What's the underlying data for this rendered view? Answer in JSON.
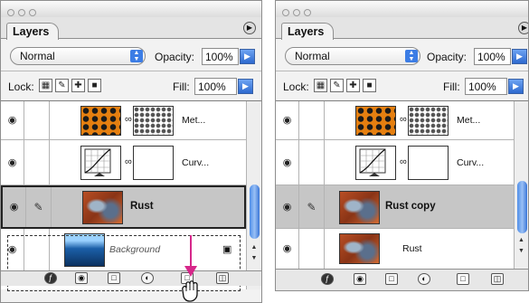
{
  "panels": [
    {
      "tab_title": "Layers",
      "blend_mode": "Normal",
      "opacity_label": "Opacity:",
      "opacity_value": "100%",
      "lock_label": "Lock:",
      "fill_label": "Fill:",
      "fill_value": "100%",
      "layers": [
        {
          "name": "Met...",
          "thumb": "honeycomb",
          "mask": "hex-mask",
          "selected": false,
          "visible": true,
          "brush": false
        },
        {
          "name": "Curv...",
          "thumb": "curves-adjustment",
          "mask": "blank-mask",
          "selected": false,
          "visible": true,
          "brush": false
        },
        {
          "name": "Rust",
          "thumb": "rust-texture",
          "selected": true,
          "visible": true,
          "brush": true
        },
        {
          "name": "Background",
          "thumb": "ocean-photo",
          "selected": false,
          "visible": true,
          "brush": false,
          "locked": true
        }
      ],
      "annotation": {
        "drag_target": "new-layer-button",
        "cursor": "grab-hand-cursor",
        "arrow_color": "#d6278a"
      }
    },
    {
      "tab_title": "Layers",
      "blend_mode": "Normal",
      "opacity_label": "Opacity:",
      "opacity_value": "100%",
      "lock_label": "Lock:",
      "fill_label": "Fill:",
      "fill_value": "100%",
      "layers": [
        {
          "name": "Met...",
          "thumb": "honeycomb",
          "mask": "hex-mask",
          "selected": false,
          "visible": true,
          "brush": false
        },
        {
          "name": "Curv...",
          "thumb": "curves-adjustment",
          "mask": "blank-mask",
          "selected": false,
          "visible": true,
          "brush": false
        },
        {
          "name": "Rust copy",
          "thumb": "rust-texture",
          "selected": true,
          "visible": true,
          "brush": true
        },
        {
          "name": "Rust",
          "thumb": "rust-texture",
          "selected": false,
          "visible": true,
          "brush": false
        }
      ]
    }
  ],
  "icons": {
    "bottom_bar": [
      "layer-style-icon",
      "add-mask-icon",
      "new-set-icon",
      "adjustment-layer-icon",
      "new-layer-icon",
      "trash-icon"
    ]
  },
  "colors": {
    "selection": "#c6c6c6",
    "accent": "#3c7de5",
    "annotation_arrow": "#d6278a"
  }
}
